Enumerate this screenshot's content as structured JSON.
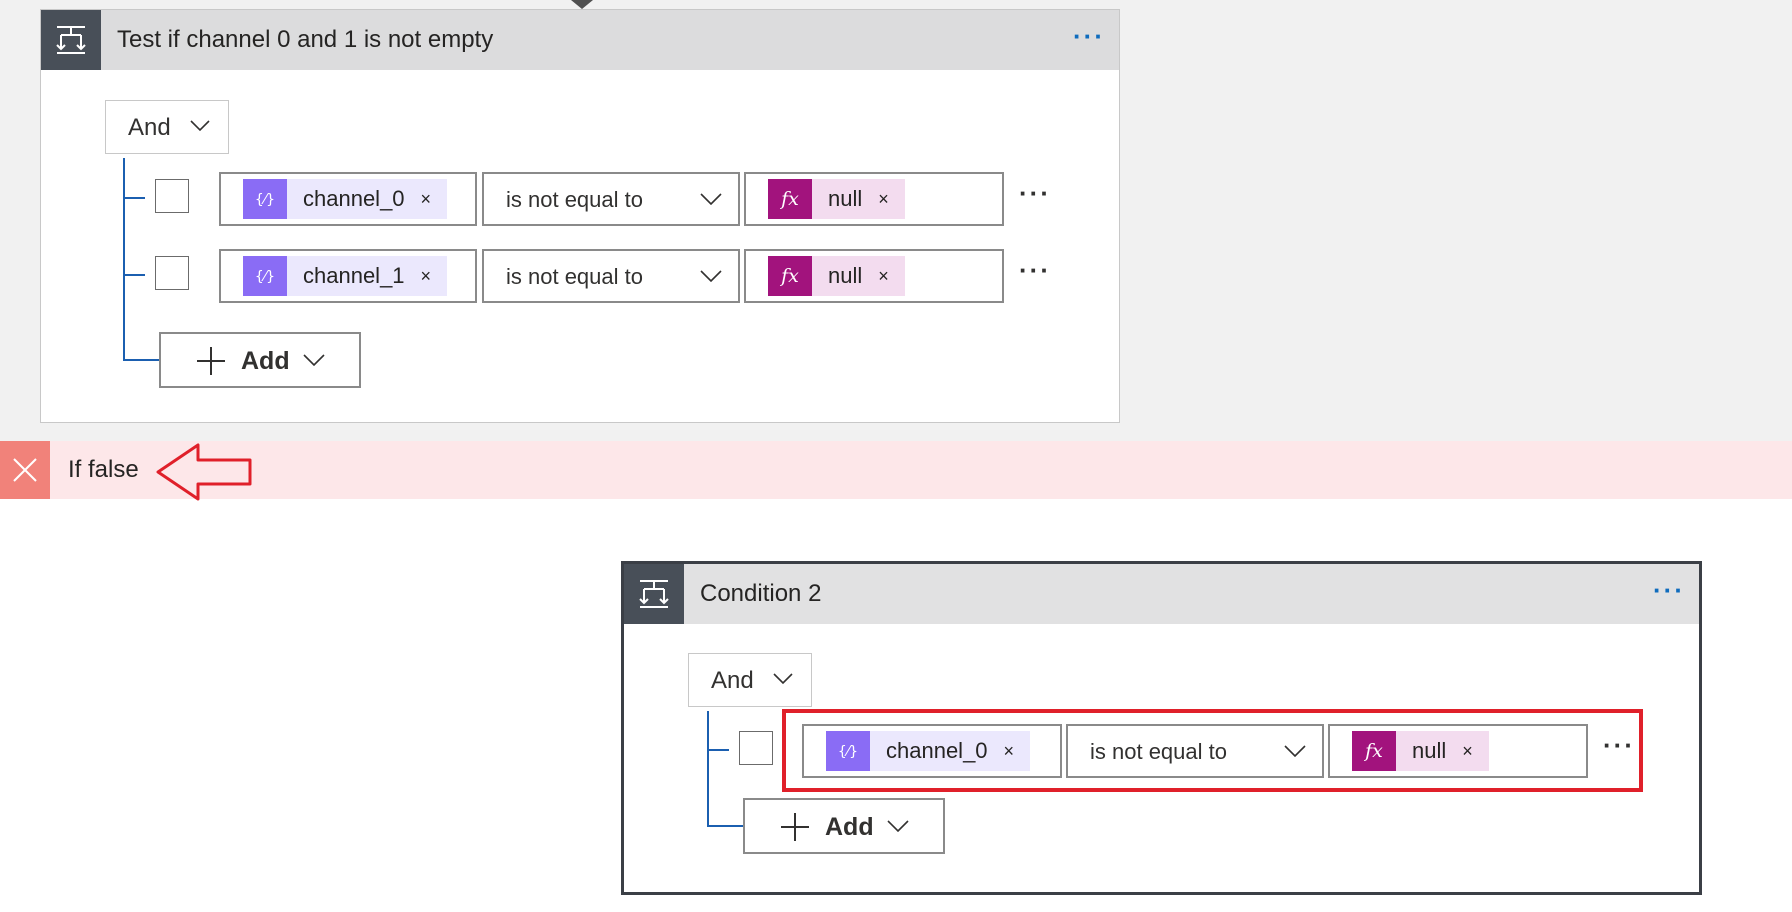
{
  "condition1": {
    "title": "Test if channel 0 and 1 is not empty",
    "more": "···",
    "group_operator": "And",
    "rows": [
      {
        "field": "channel_0",
        "operator": "is not equal to",
        "value": "null",
        "remove": "×",
        "more": "···"
      },
      {
        "field": "channel_1",
        "operator": "is not equal to",
        "value": "null",
        "remove": "×",
        "more": "···"
      }
    ],
    "add_label": "Add"
  },
  "branch": {
    "label": "If false"
  },
  "condition2": {
    "title": "Condition 2",
    "more": "···",
    "group_operator": "And",
    "rows": [
      {
        "field": "channel_0",
        "operator": "is not equal to",
        "value": "null",
        "remove": "×",
        "more": "···"
      }
    ],
    "add_label": "Add"
  },
  "icons": {
    "condition": "condition-icon",
    "dynamic_content": "dynamic-content-icon",
    "expression": "fx-icon",
    "chevron": "chevron-down-icon",
    "plus": "plus-icon",
    "close": "close-icon",
    "annotation_arrow": "red-arrow-icon"
  },
  "colors": {
    "header_bg": "#dcdcdd",
    "header_icon_bg": "#484f58",
    "dynamic_token": "#8a6cf5",
    "expression_token": "#a2137d",
    "tree_line": "#1b5fb0",
    "if_false_bg": "#fde7e9",
    "if_false_icon": "#f1827a",
    "highlight": "#e0202a"
  }
}
